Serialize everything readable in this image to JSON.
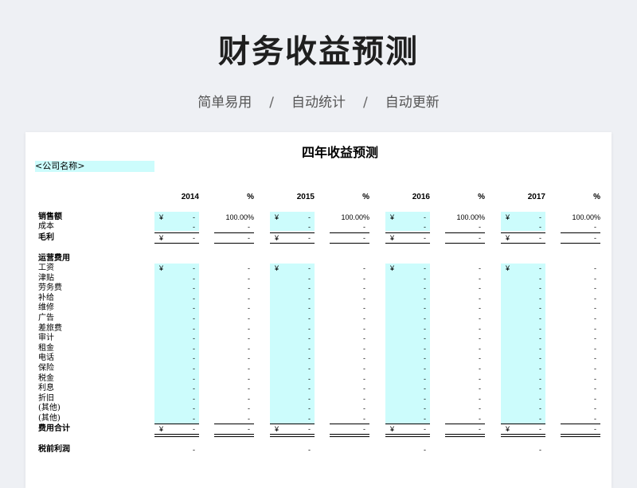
{
  "header": {
    "title": "财务收益预测",
    "tags": [
      "简单易用",
      "自动统计",
      "自动更新"
    ],
    "separator": "/"
  },
  "sheet": {
    "title": "四年收益预测",
    "company_placeholder": "<公司名称>",
    "years": [
      "2014",
      "2015",
      "2016",
      "2017"
    ],
    "pct_header": "%",
    "currency": "¥",
    "dash": "-",
    "revenue_pct": "100.00%",
    "rows": {
      "sales": "销售额",
      "cost": "成本",
      "gross_profit": "毛利",
      "opex_header": "运营费用",
      "expenses": [
        "工资",
        "津贴",
        "劳务费",
        "补给",
        "维修",
        "广告",
        "差旅费",
        "审计",
        "租金",
        "电话",
        "保险",
        "税金",
        "利息",
        "折旧",
        "(其他)",
        "(其他)"
      ],
      "total_expenses": "费用合计",
      "pretax_profit": "税前利润"
    }
  },
  "colors": {
    "highlight": "#ccfcfc",
    "background": "#eef0f4"
  }
}
